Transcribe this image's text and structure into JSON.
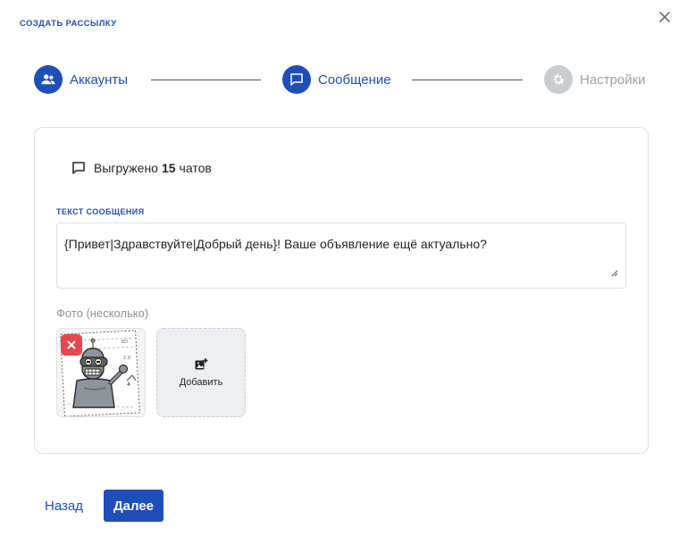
{
  "dialog": {
    "title": "СОЗДАТЬ РАССЫЛКУ",
    "close_icon": "close-icon"
  },
  "stepper": {
    "steps": [
      {
        "label": "Аккаунты",
        "icon": "users-icon",
        "state": "active"
      },
      {
        "label": "Сообщение",
        "icon": "chat-icon",
        "state": "active"
      },
      {
        "label": "Настройки",
        "icon": "gear-icon",
        "state": "inactive"
      }
    ]
  },
  "card": {
    "export": {
      "icon": "chat-outline-icon",
      "prefix": "Выгружено",
      "count": "15",
      "suffix": "чатов"
    },
    "message_label": "ТЕКСТ СООБЩЕНИЯ",
    "message_value": "{Привет|Здравствуйте|Добрый день}! Ваше объявление ещё актуально?",
    "photos_label": "Фото (несколько)",
    "photos": [
      {
        "icon": "robot-image",
        "remove_icon": "close-icon"
      }
    ],
    "add_photo_label": "Добавить",
    "add_photo_icon": "add-photo-icon"
  },
  "footer": {
    "back_label": "Назад",
    "next_label": "Далее"
  },
  "colors": {
    "accent": "#1e4fb8",
    "inactive": "#c9ccd1",
    "danger": "#e5484d"
  }
}
